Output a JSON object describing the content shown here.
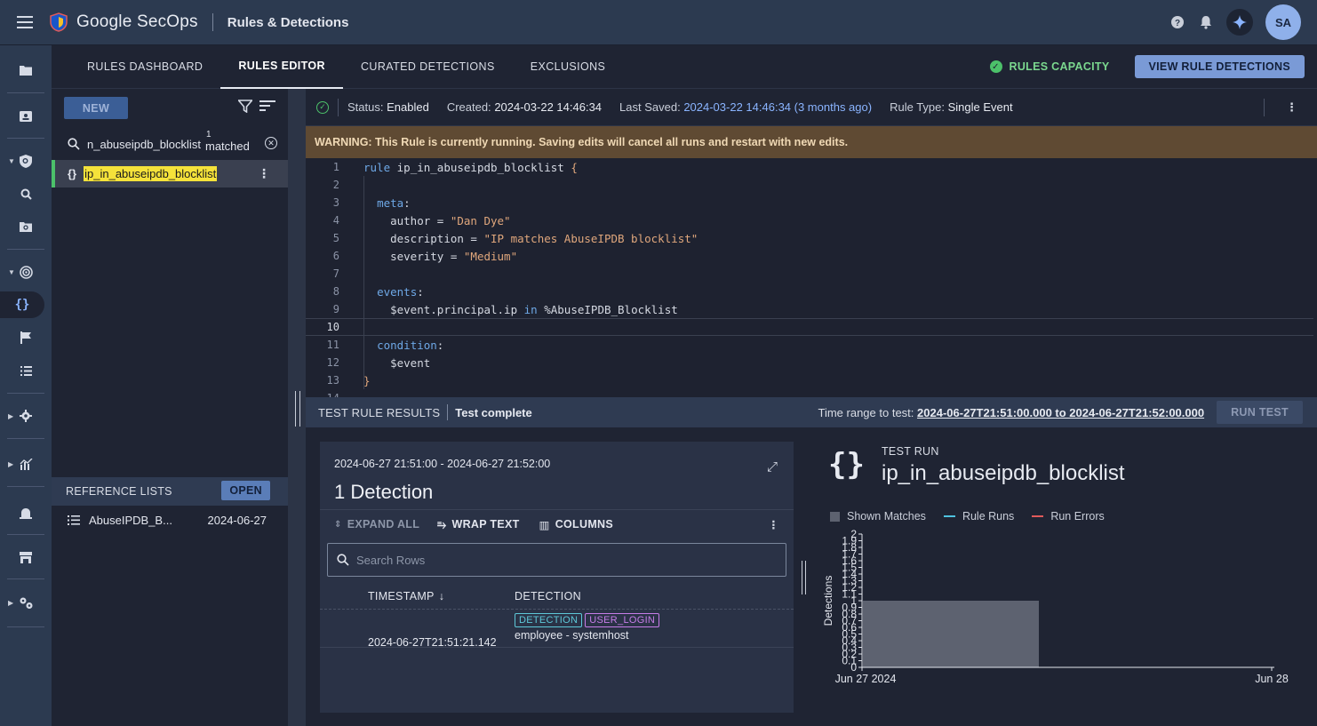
{
  "app": {
    "brand": "Google SecOps",
    "page_title": "Rules & Detections",
    "avatar_initials": "SA",
    "accent_color": "#7a9ad6"
  },
  "tabs": [
    {
      "label": "RULES DASHBOARD",
      "active": false
    },
    {
      "label": "RULES EDITOR",
      "active": true
    },
    {
      "label": "CURATED DETECTIONS",
      "active": false
    },
    {
      "label": "EXCLUSIONS",
      "active": false
    }
  ],
  "header_actions": {
    "capacity_label": "RULES CAPACITY",
    "view_detections_label": "VIEW RULE DETECTIONS"
  },
  "rules_panel": {
    "new_label": "NEW",
    "search_value": "n_abuseipdb_blocklist",
    "matched_count": "1",
    "matched_label": "matched",
    "selected_rule": "ip_in_abuseipdb_blocklist",
    "reference_lists_label": "REFERENCE LISTS",
    "open_label": "OPEN",
    "reference_list": {
      "name": "AbuseIPDB_B...",
      "date": "2024-06-27"
    }
  },
  "status_bar": {
    "status_label": "Status:",
    "status_value": "Enabled",
    "created_label": "Created:",
    "created_value": "2024-03-22 14:46:34",
    "saved_label": "Last Saved:",
    "saved_value": "2024-03-22 14:46:34 (3 months ago)",
    "type_label": "Rule Type:",
    "type_value": "Single Event"
  },
  "warning": "WARNING: This Rule is currently running. Saving edits will cancel all runs and restart with new edits.",
  "editor": {
    "line_numbers": [
      "1",
      "2",
      "3",
      "4",
      "5",
      "6",
      "7",
      "8",
      "9",
      "10",
      "11",
      "12",
      "13",
      "14"
    ],
    "rule_kw": "rule",
    "rule_name": "ip_in_abuseipdb_blocklist",
    "open_brace": "{",
    "close_brace": "}",
    "meta_kw": "meta",
    "author_key": "author",
    "author_val": "\"Dan Dye\"",
    "desc_key": "description",
    "desc_val": "\"IP matches AbuseIPDB blocklist\"",
    "sev_key": "severity",
    "sev_val": "\"Medium\"",
    "events_kw": "events",
    "event_expr": "$event.principal.ip",
    "in_kw": "in",
    "ref_list": "%AbuseIPDB_Blocklist",
    "condition_kw": "condition",
    "condition_expr": "$event"
  },
  "test_results": {
    "title": "TEST RULE RESULTS",
    "status": "Test complete",
    "range_label": "Time range to test:",
    "range_value": "2024-06-27T21:51:00.000 to 2024-06-27T21:52:00.000",
    "run_label": "RUN TEST"
  },
  "detections_card": {
    "range": "2024-06-27 21:51:00 - 2024-06-27 21:52:00",
    "title": "1 Detection",
    "expand_all": "EXPAND ALL",
    "wrap_text": "WRAP TEXT",
    "columns": "COLUMNS",
    "search_placeholder": "Search Rows",
    "col_timestamp": "TIMESTAMP",
    "col_detection": "DETECTION",
    "row": {
      "timestamp": "2024-06-27T21:51:21.142",
      "chips": [
        "DETECTION",
        "USER_LOGIN"
      ],
      "summary": "employee - systemhost"
    }
  },
  "test_run": {
    "label": "TEST RUN",
    "rule_name": "ip_in_abuseipdb_blocklist",
    "legend": [
      {
        "name": "Shown Matches",
        "color": "#5d6270"
      },
      {
        "name": "Rule Runs",
        "color": "#4fc3e0"
      },
      {
        "name": "Run Errors",
        "color": "#e05a5a"
      }
    ]
  },
  "chart_data": {
    "type": "bar",
    "ylabel": "Detections",
    "ylim": [
      0,
      2
    ],
    "yticks": [
      "0",
      "0.1",
      "0.2",
      "0.3",
      "0.4",
      "0.5",
      "0.6",
      "0.7",
      "0.8",
      "0.9",
      "1",
      "1.1",
      "1.2",
      "1.3",
      "1.4",
      "1.5",
      "1.6",
      "1.7",
      "1.8",
      "1.9",
      "2"
    ],
    "x_tick_labels": [
      "Jun 27 2024",
      "Jun 28"
    ],
    "series": [
      {
        "name": "Shown Matches",
        "values": [
          1
        ]
      }
    ],
    "bar_color": "#5d6270",
    "axis_color": "#e3e6ee"
  }
}
